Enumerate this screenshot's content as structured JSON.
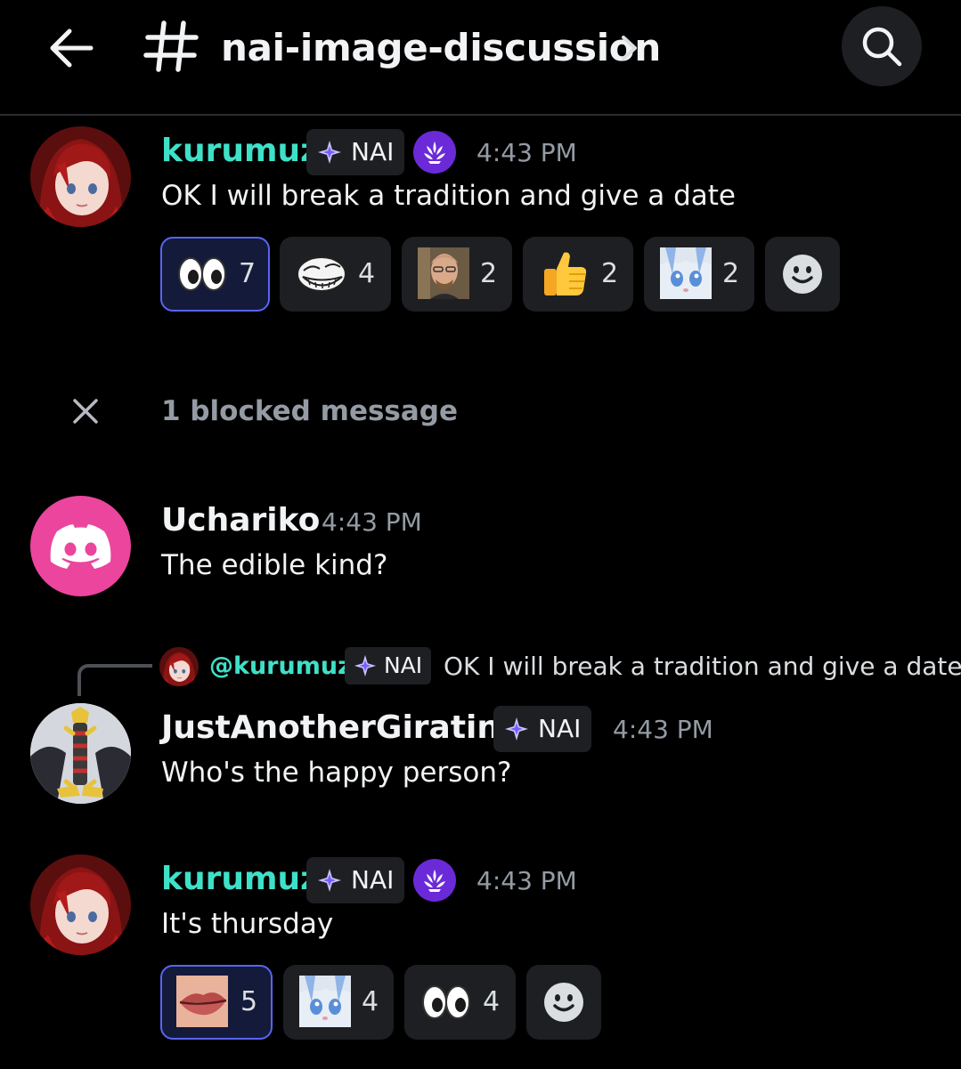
{
  "header": {
    "channel_name": "nai-image-discussion",
    "icons": [
      "back-arrow-icon",
      "hash-icon",
      "chevron-right-icon",
      "search-icon"
    ]
  },
  "colors": {
    "background": "#000000",
    "username_teal": "#3fe0c8",
    "selected_reaction_border": "#5865f2",
    "badge_purple": "#6b2ad8",
    "discord_pink": "#eb459e"
  },
  "messages": [
    {
      "author": "kurumuz",
      "tag": "NAI",
      "time": "4:43 PM",
      "text": "OK I will break a tradition and give a date",
      "reactions": [
        {
          "emoji": "eyes",
          "count": "7",
          "selected": true
        },
        {
          "emoji": "trollface",
          "count": "4",
          "selected": false
        },
        {
          "emoji": "walter-white",
          "count": "2",
          "selected": false
        },
        {
          "emoji": "thumbs-up",
          "count": "2",
          "selected": false
        },
        {
          "emoji": "gura-face",
          "count": "2",
          "selected": false
        }
      ]
    },
    {
      "blocked_text": "1 blocked message"
    },
    {
      "author": "Uchariko",
      "time": "4:43 PM",
      "text": "The edible kind?"
    },
    {
      "reply": {
        "author": "@kurumuz",
        "tag": "NAI",
        "text": "OK I will break a tradition and give a date"
      },
      "author": "JustAnotherGiratina",
      "tag": "NAI",
      "time": "4:43 PM",
      "text": "Who's the happy person?"
    },
    {
      "author": "kurumuz",
      "tag": "NAI",
      "time": "4:43 PM",
      "text": "It's thursday",
      "reactions": [
        {
          "emoji": "lips-closeup",
          "count": "5",
          "selected": true
        },
        {
          "emoji": "gura-face",
          "count": "4",
          "selected": false
        },
        {
          "emoji": "eyes",
          "count": "4",
          "selected": false
        }
      ]
    }
  ]
}
